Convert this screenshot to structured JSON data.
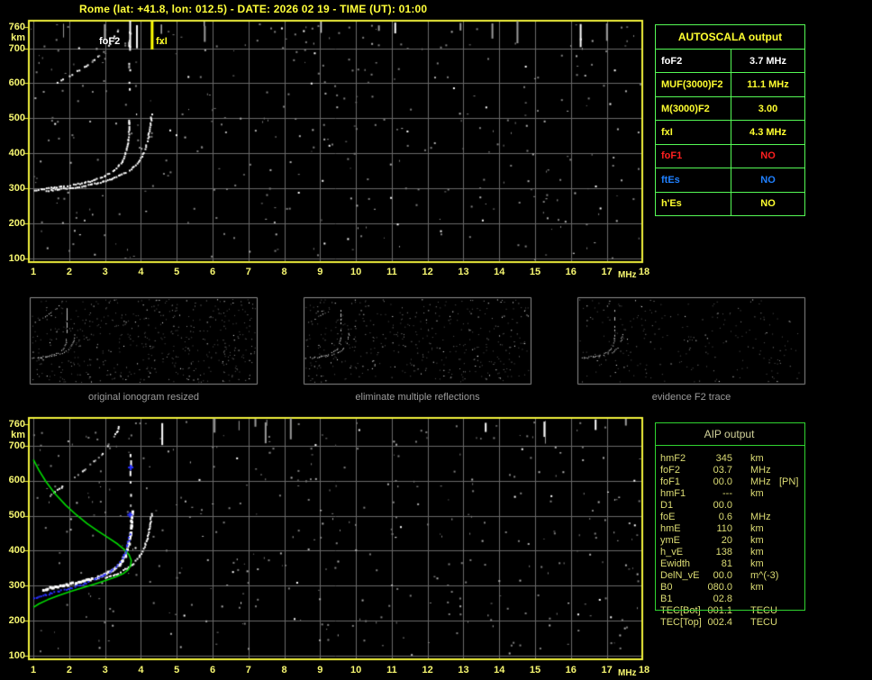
{
  "title": "Rome (lat: +41.8, lon: 012.5) - DATE: 2026 02 19 - TIME (UT): 01:00",
  "colors": {
    "background": "#000000",
    "frame_yellow": "#f2f23c",
    "grid_gray": "#6a6a6a",
    "tick_label": "#f6f670",
    "title_yellow": "#ffff3a",
    "autoscala_border": "#55fa55",
    "aip_border": "#30d430",
    "aip_text": "#dcdc74",
    "caption_gray": "#9c9c9c",
    "thumb_border": "#8e8e8e",
    "trace_white": "#ffffff",
    "profile_green": "#00dc00",
    "scaled_trace_blue": "#2830ff",
    "fof2_marker": "#ffffff",
    "fxi_marker": "#ffff00"
  },
  "axes": {
    "x_ticks": [
      "1",
      "2",
      "3",
      "4",
      "5",
      "6",
      "7",
      "8",
      "9",
      "10",
      "11",
      "12",
      "13",
      "14",
      "15",
      "16",
      "17",
      "18"
    ],
    "x_unit": "MHz",
    "y_ticks": [
      "760",
      "km",
      "700",
      "600",
      "500",
      "400",
      "300",
      "200",
      "100"
    ]
  },
  "top_plot": {
    "fof2_label": "foF2",
    "fxi_label": "fxI",
    "fof2_mhz": 3.7,
    "fxi_mhz": 4.3,
    "curves": {
      "o_trace": [
        [
          1.02,
          297
        ],
        [
          1.35,
          302
        ],
        [
          1.7,
          306
        ],
        [
          2.05,
          311
        ],
        [
          2.4,
          318
        ],
        [
          2.7,
          327
        ],
        [
          3.0,
          339
        ],
        [
          3.25,
          355
        ],
        [
          3.42,
          373
        ],
        [
          3.52,
          393
        ],
        [
          3.59,
          417
        ],
        [
          3.63,
          443
        ],
        [
          3.65,
          468
        ]
      ],
      "x_trace": [
        [
          1.35,
          295
        ],
        [
          1.75,
          300
        ],
        [
          2.15,
          305
        ],
        [
          2.5,
          311
        ],
        [
          2.85,
          319
        ],
        [
          3.15,
          329
        ],
        [
          3.45,
          342
        ],
        [
          3.7,
          357
        ],
        [
          3.88,
          374
        ],
        [
          4.0,
          393
        ],
        [
          4.1,
          415
        ],
        [
          4.17,
          440
        ],
        [
          4.22,
          466
        ],
        [
          4.26,
          495
        ],
        [
          4.28,
          518
        ]
      ],
      "second_hop": [
        [
          1.25,
          578
        ],
        [
          1.55,
          597
        ],
        [
          1.85,
          615
        ],
        [
          2.15,
          633
        ],
        [
          2.45,
          652
        ],
        [
          2.7,
          670
        ],
        [
          2.9,
          688
        ],
        [
          3.08,
          708
        ],
        [
          3.2,
          727
        ],
        [
          3.3,
          745
        ],
        [
          3.36,
          760
        ]
      ],
      "asymptote": {
        "mhz": 3.66,
        "h_min": 478,
        "h_max": 758
      }
    }
  },
  "autoscala_table": {
    "title": "AUTOSCALA output",
    "rows": [
      {
        "label": "foF2",
        "value": "3.7 MHz",
        "color": "#ffffff"
      },
      {
        "label": "MUF(3000)F2",
        "value": "11.1 MHz",
        "color": "#ffff30"
      },
      {
        "label": "M(3000)F2",
        "value": "3.00",
        "color": "#ffff30"
      },
      {
        "label": "fxI",
        "value": "4.3 MHz",
        "color": "#ffff30"
      },
      {
        "label": "foF1",
        "value": "NO",
        "color": "#ff2020"
      },
      {
        "label": "ftEs",
        "value": "NO",
        "color": "#2080ff"
      },
      {
        "label": "h'Es",
        "value": "NO",
        "color": "#ffff30"
      }
    ]
  },
  "thumbnails": [
    {
      "caption": "original ionogram resized"
    },
    {
      "caption": "eliminate multiple reflections"
    },
    {
      "caption": "evidence F2 trace"
    }
  ],
  "bottom_plot": {
    "curves": {
      "o_trace": [
        [
          1.25,
          293
        ],
        [
          1.6,
          300
        ],
        [
          1.95,
          307
        ],
        [
          2.3,
          315
        ],
        [
          2.65,
          324
        ],
        [
          2.95,
          335
        ],
        [
          3.2,
          349
        ],
        [
          3.4,
          366
        ],
        [
          3.53,
          387
        ],
        [
          3.61,
          412
        ],
        [
          3.66,
          441
        ],
        [
          3.69,
          472
        ],
        [
          3.71,
          505
        ],
        [
          3.72,
          522
        ]
      ],
      "x_trace": [
        [
          3.0,
          324
        ],
        [
          3.3,
          335
        ],
        [
          3.55,
          349
        ],
        [
          3.76,
          365
        ],
        [
          3.92,
          383
        ],
        [
          4.04,
          404
        ],
        [
          4.13,
          428
        ],
        [
          4.2,
          456
        ],
        [
          4.25,
          487
        ],
        [
          4.28,
          514
        ]
      ],
      "second_hop": [
        [
          1.45,
          560
        ],
        [
          1.75,
          582
        ],
        [
          2.05,
          605
        ],
        [
          2.35,
          628
        ],
        [
          2.62,
          652
        ],
        [
          2.87,
          676
        ],
        [
          3.07,
          700
        ],
        [
          3.22,
          723
        ],
        [
          3.32,
          744
        ],
        [
          3.39,
          760
        ]
      ],
      "asymptote": {
        "mhz": 3.7,
        "h_min": 520,
        "h_max": 690
      },
      "profile_green": [
        [
          1.0,
          660
        ],
        [
          1.15,
          630
        ],
        [
          1.35,
          597
        ],
        [
          1.6,
          563
        ],
        [
          1.9,
          530
        ],
        [
          2.2,
          502
        ],
        [
          2.5,
          477
        ],
        [
          2.8,
          456
        ],
        [
          3.1,
          436
        ],
        [
          3.35,
          419
        ],
        [
          3.55,
          402
        ],
        [
          3.67,
          388
        ],
        [
          3.73,
          372
        ],
        [
          3.71,
          357
        ],
        [
          3.64,
          345
        ],
        [
          3.5,
          334
        ],
        [
          3.3,
          325
        ],
        [
          3.05,
          316
        ],
        [
          2.75,
          306
        ],
        [
          2.4,
          295
        ],
        [
          2.05,
          284
        ],
        [
          1.7,
          272
        ],
        [
          1.4,
          260
        ],
        [
          1.15,
          248
        ],
        [
          1.0,
          238
        ]
      ],
      "scaled_blue": [
        [
          1.0,
          268
        ],
        [
          1.3,
          276
        ],
        [
          1.6,
          284
        ],
        [
          1.95,
          294
        ],
        [
          2.3,
          305
        ],
        [
          2.65,
          318
        ],
        [
          2.95,
          332
        ],
        [
          3.2,
          349
        ],
        [
          3.38,
          369
        ],
        [
          3.52,
          391
        ],
        [
          3.6,
          414
        ],
        [
          3.65,
          438
        ],
        [
          3.67,
          456
        ]
      ],
      "blue_isolated": [
        [
          3.67,
          505
        ],
        [
          3.69,
          640
        ]
      ]
    }
  },
  "aip_table": {
    "title": "AIP output",
    "rows": [
      {
        "label": "hmF2",
        "value": "345",
        "unit": "km",
        "extra": ""
      },
      {
        "label": "foF2",
        "value": "03.7",
        "unit": "MHz",
        "extra": ""
      },
      {
        "label": "foF1",
        "value": "00.0",
        "unit": "MHz",
        "extra": "[PN]"
      },
      {
        "label": "hmF1",
        "value": "---",
        "unit": "km",
        "extra": ""
      },
      {
        "label": "D1",
        "value": "00.0",
        "unit": "",
        "extra": ""
      },
      {
        "label": "foE",
        "value": "0.6",
        "unit": "MHz",
        "extra": ""
      },
      {
        "label": "hmE",
        "value": "110",
        "unit": "km",
        "extra": ""
      },
      {
        "label": "ymE",
        "value": "20",
        "unit": "km",
        "extra": ""
      },
      {
        "label": "h_vE",
        "value": "138",
        "unit": "km",
        "extra": ""
      },
      {
        "label": "Ewidth",
        "value": "81",
        "unit": "km",
        "extra": ""
      },
      {
        "label": "DelN_vE",
        "value": "00.0",
        "unit": "m^(-3)",
        "extra": ""
      },
      {
        "label": "B0",
        "value": "080.0",
        "unit": "km",
        "extra": ""
      },
      {
        "label": "B1",
        "value": "02.8",
        "unit": "",
        "extra": ""
      },
      {
        "label": "TEC[Bot]",
        "value": "001.1",
        "unit": "TECU",
        "extra": ""
      },
      {
        "label": "TEC[Top]",
        "value": "002.4",
        "unit": "TECU",
        "extra": ""
      }
    ]
  },
  "noise": {
    "seed": 20260219,
    "plot_speck_count": 380,
    "streak_count": 14,
    "thumb_speck_counts": [
      520,
      430,
      230
    ]
  }
}
